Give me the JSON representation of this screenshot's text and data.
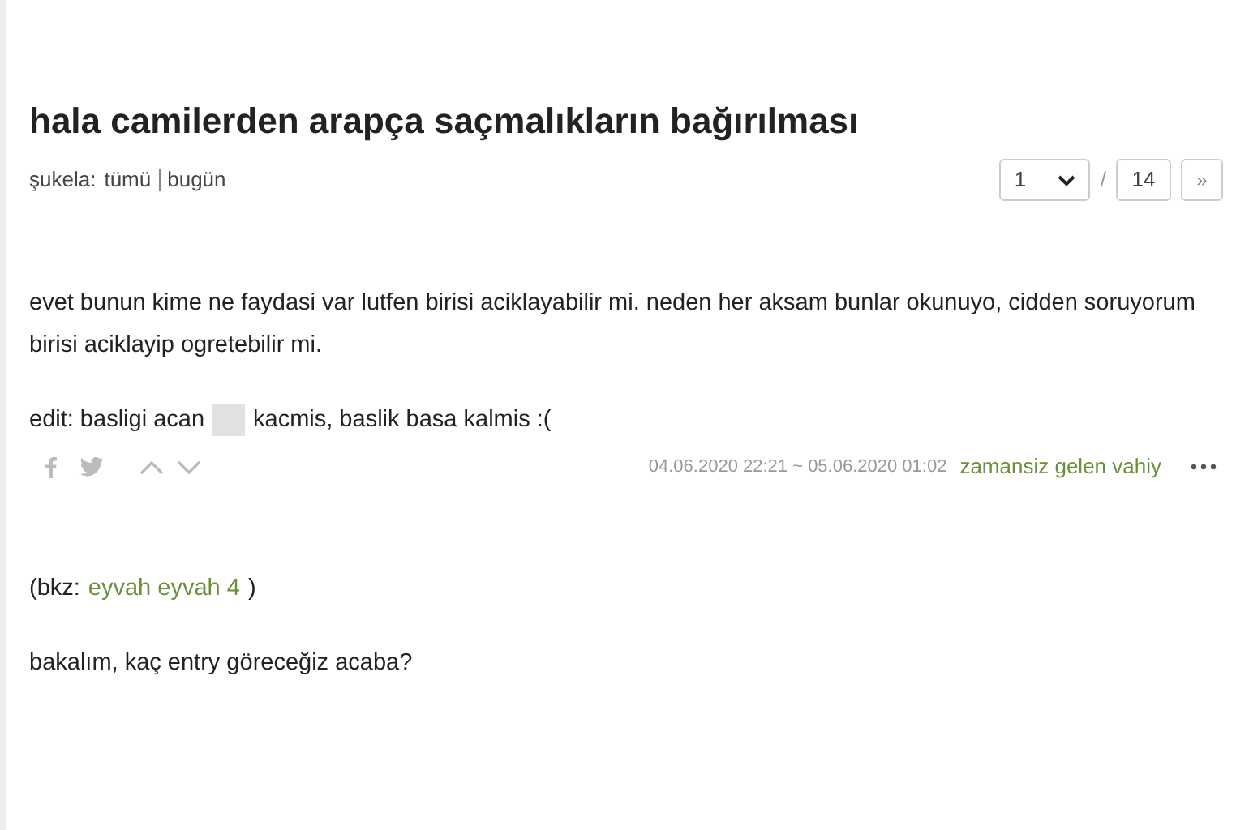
{
  "title": "hala camilerden arapça saçmalıkların bağırılması",
  "filter": {
    "label": "şukela:",
    "options": [
      {
        "label": "tümü"
      },
      {
        "label": "bugün"
      }
    ]
  },
  "pager": {
    "page": "1",
    "total": "14",
    "next": "»",
    "separator": "/"
  },
  "entries": [
    {
      "paragraphs": [
        {
          "parts": [
            {
              "kind": "text",
              "text": "evet bunun kime ne faydasi var lutfen birisi aciklayabilir mi. neden her aksam bunlar okunuyo, cidden soruyorum birisi aciklayip ogretebilir mi."
            }
          ]
        },
        {
          "parts": [
            {
              "kind": "text",
              "text": "edit: basligi acan"
            },
            {
              "kind": "redacted"
            },
            {
              "kind": "text",
              "text": "kacmis, baslik basa kalmis :("
            }
          ]
        }
      ],
      "date": "04.06.2020 22:21 ~ 05.06.2020 01:02",
      "author": "zamansiz gelen vahiy"
    },
    {
      "paragraphs": [
        {
          "parts": [
            {
              "kind": "text",
              "text": "(bkz:"
            },
            {
              "kind": "link",
              "text": "eyvah eyvah 4"
            },
            {
              "kind": "text",
              "text": ")"
            }
          ]
        },
        {
          "parts": [
            {
              "kind": "text",
              "text": "bakalım, kaç entry göreceğiz acaba?"
            }
          ]
        }
      ]
    }
  ]
}
